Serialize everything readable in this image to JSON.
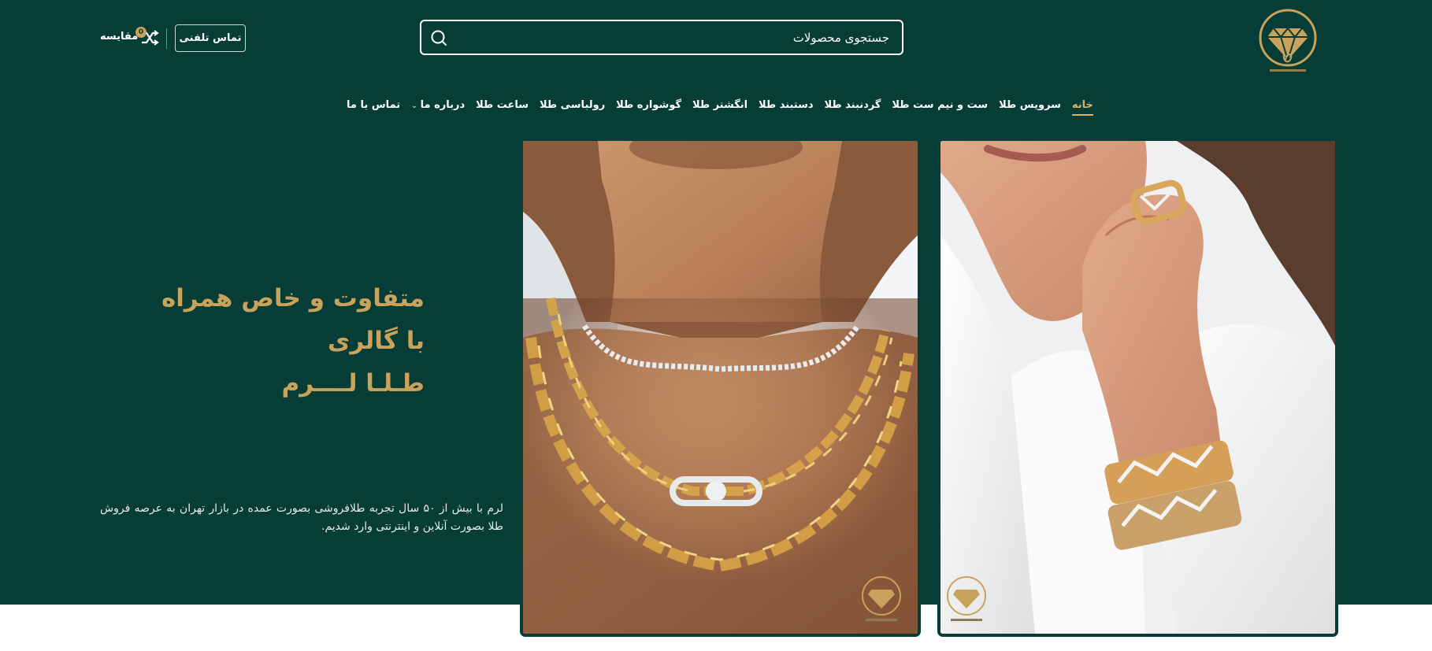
{
  "header": {
    "logo_name": "diamond-logo",
    "search": {
      "placeholder": "جستجوی محصولات"
    },
    "call_button": "تماس تلفنی",
    "compare": {
      "label": "مقایسه",
      "count": "0"
    }
  },
  "nav": {
    "items": [
      {
        "label": "خانه",
        "active": true
      },
      {
        "label": "سرویس طلا"
      },
      {
        "label": "ست و نیم ست طلا"
      },
      {
        "label": "گردنبند طلا"
      },
      {
        "label": "دستبند طلا"
      },
      {
        "label": "انگشتر طلا"
      },
      {
        "label": "گوشواره طلا"
      },
      {
        "label": "رولباسی طلا"
      },
      {
        "label": "ساعت طلا"
      },
      {
        "label": "درباره ما",
        "has_dropdown": true
      },
      {
        "label": "تماس با ما"
      }
    ]
  },
  "hero": {
    "headline_lines": [
      "متفاوت و خاص همراه",
      "با گالری",
      "طـلـا لــــرم"
    ],
    "description": "لرم با بیش از ۵۰ سال تجربه طلافروشی بصورت عمده در بازار تهران به عرصه فروش طلا بصورت آنلاین و اینترنتی وارد شدیم."
  },
  "images": [
    {
      "name": "necklace-photo",
      "subject": "gold chain necklaces and diamond choker"
    },
    {
      "name": "ring-bracelet-photo",
      "subject": "gold ring and bracelets on hand"
    }
  ],
  "colors": {
    "brand_green": "#063d36",
    "gold": "#c9a25b",
    "active_nav": "#d8b56c"
  }
}
